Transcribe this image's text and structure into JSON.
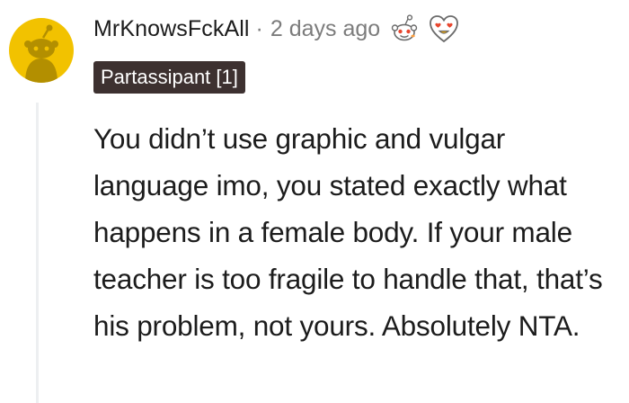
{
  "comment": {
    "author": "MrKnowsFckAll",
    "separator": "·",
    "timestamp": "2 days ago",
    "flair": "Partassipant [1]",
    "awards": [
      "wholesome-award-icon",
      "heart-eyes-award-icon"
    ],
    "body": "You didn’t use graphic and vulgar language imo, you stated exactly what happens in a female body. If your male teacher is too fragile to handle that, that’s his problem, not yours. Absolutely NTA."
  },
  "colors": {
    "avatar_bg": "#f2c200",
    "avatar_figure": "#b38f00",
    "flair_bg": "#3d3130",
    "flair_text": "#ffffff",
    "meta_text": "#7c7c7c",
    "body_text": "#1c1c1c",
    "thread_line": "#edeff1"
  }
}
